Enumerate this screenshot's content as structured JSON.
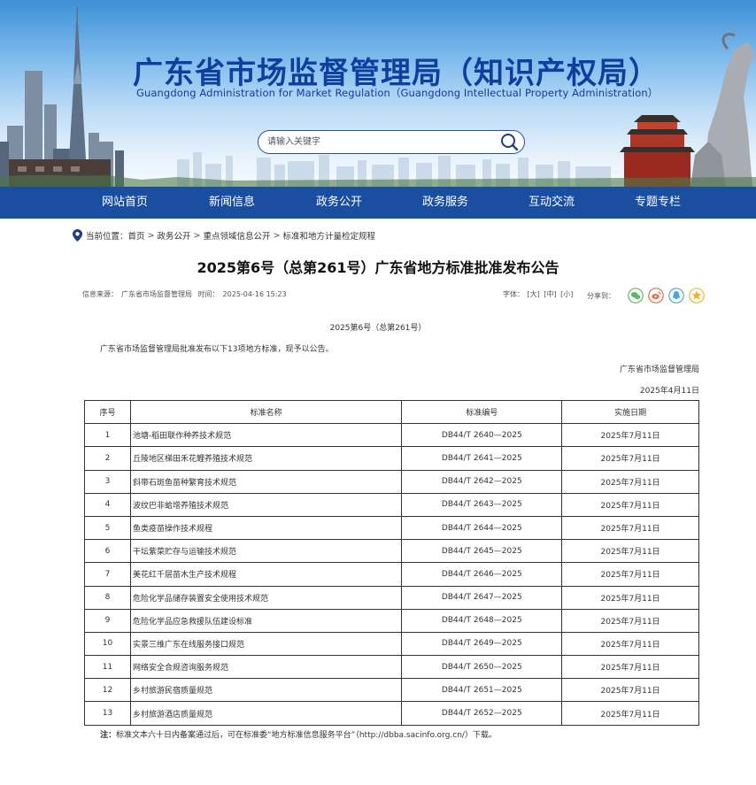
{
  "header": {
    "title": "广东省市场监督管理局（知识产权局）",
    "subtitle": "Guangdong Administration for Market Regulation（Guangdong Intellectual Property Administration）",
    "search_placeholder": "请输入关键字"
  },
  "nav": {
    "items": [
      "网站首页",
      "新闻信息",
      "政务公开",
      "政务服务",
      "互动交流",
      "专题专栏"
    ]
  },
  "breadcrumb": {
    "label": "当前位置：",
    "items": [
      "首页",
      "政务公开",
      "重点领域信息公开",
      "标准和地方计量检定规程"
    ],
    "separator": ">"
  },
  "article": {
    "title": "2025第6号（总第261号）广东省地方标准批准发布公告",
    "source_label": "信息来源：",
    "source": "广东省市场监督管理局",
    "time_label": "时间：",
    "time": "2025-04-16 15:23",
    "font_label": "字体：",
    "font_sizes": [
      "[大]",
      "[中]",
      "[小]"
    ],
    "share_label": "分享到：",
    "doc_number": "2025第6号（总第261号）",
    "intro": "广东省市场监督管理局批准发布以下13项地方标准，现予以公告。",
    "issuer": "广东省市场监督管理局",
    "issue_date": "2025年4月11日",
    "note_label": "注：",
    "note": "标准文本六十日内备案通过后，可在标准委“地方标准信息服务平台”（http://dbba.sacinfo.org.cn/）下载。"
  },
  "table": {
    "headers": [
      "序号",
      "标准名称",
      "标准编号",
      "实施日期"
    ],
    "rows": [
      [
        "1",
        "池塘-稻田联作种养技术规范",
        "DB44/T 2640—2025",
        "2025年7月11日"
      ],
      [
        "2",
        "丘陵地区梯田禾花鲤养殖技术规范",
        "DB44/T 2641—2025",
        "2025年7月11日"
      ],
      [
        "3",
        "斜带石斑鱼苗种繁育技术规范",
        "DB44/T 2642—2025",
        "2025年7月11日"
      ],
      [
        "4",
        "波纹巴非蛤增养殖技术规范",
        "DB44/T 2643—2025",
        "2025年7月11日"
      ],
      [
        "5",
        "鱼类疫苗操作技术规程",
        "DB44/T 2644—2025",
        "2025年7月11日"
      ],
      [
        "6",
        "干坛紫菜贮存与运输技术规范",
        "DB44/T 2645—2025",
        "2025年7月11日"
      ],
      [
        "7",
        "美花红千层苗木生产技术规程",
        "DB44/T 2646—2025",
        "2025年7月11日"
      ],
      [
        "8",
        "危险化学品储存装置安全使用技术规范",
        "DB44/T 2647—2025",
        "2025年7月11日"
      ],
      [
        "9",
        "危险化学品应急救援队伍建设标准",
        "DB44/T 2648—2025",
        "2025年7月11日"
      ],
      [
        "10",
        "实景三维广东在线服务接口规范",
        "DB44/T 2649—2025",
        "2025年7月11日"
      ],
      [
        "11",
        "网络安全合规咨询服务规范",
        "DB44/T 2650—2025",
        "2025年7月11日"
      ],
      [
        "12",
        "乡村旅游民宿质量规范",
        "DB44/T 2651—2025",
        "2025年7月11日"
      ],
      [
        "13",
        "乡村旅游酒店质量规范",
        "DB44/T 2652—2025",
        "2025年7月11日"
      ]
    ]
  },
  "colors": {
    "brand_blue": "#1a4ea0",
    "title_blue": "#0f3f9e",
    "wechat": "#5fb85f",
    "weibo": "#e8664a",
    "qq": "#4aa5e0",
    "qzone": "#f0b52c"
  },
  "icons": [
    "search-icon",
    "location-pin-icon",
    "wechat-icon",
    "weibo-icon",
    "qq-icon",
    "qzone-icon"
  ]
}
